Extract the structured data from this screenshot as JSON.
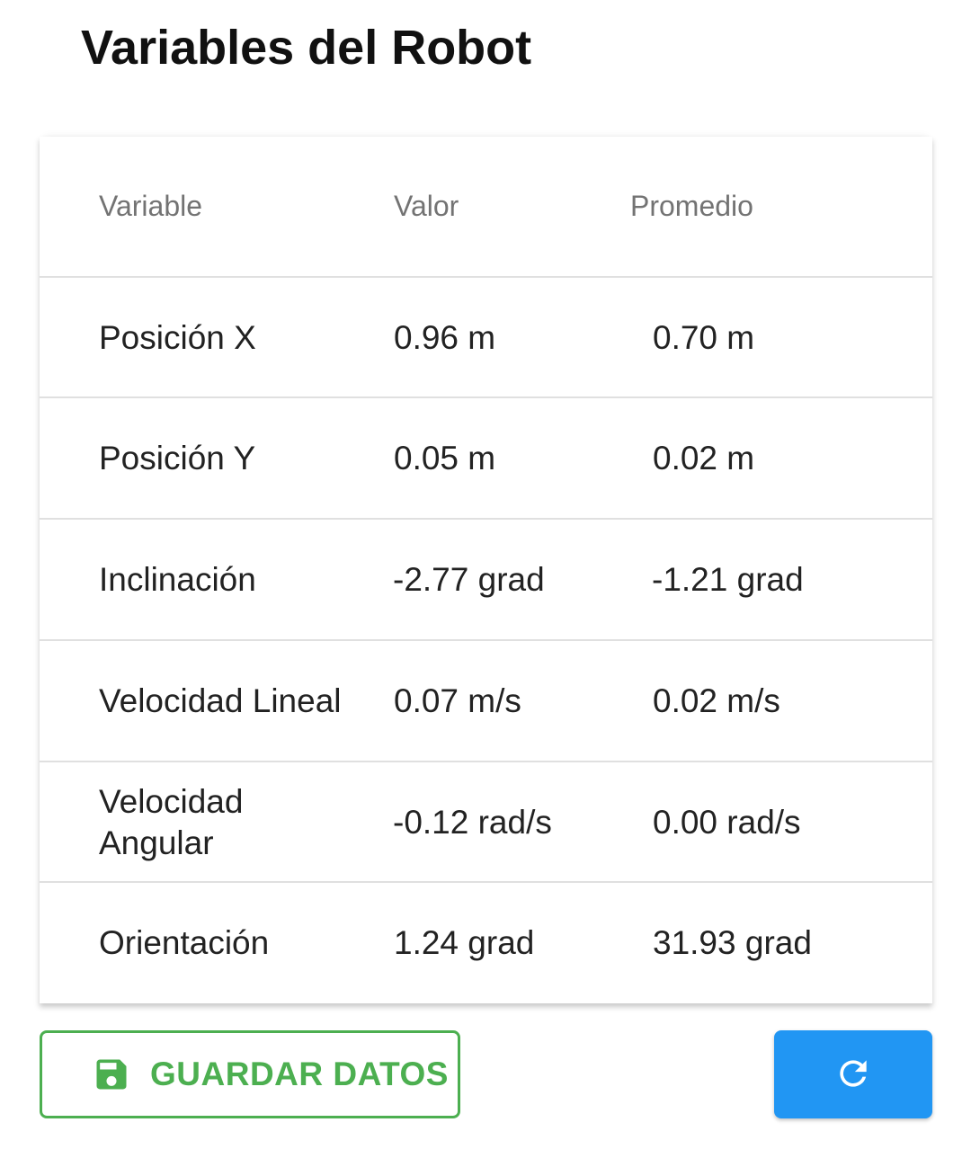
{
  "page": {
    "title": "Variables del Robot"
  },
  "table": {
    "headers": {
      "variable": "Variable",
      "value": "Valor",
      "average": "Promedio"
    },
    "rows": [
      {
        "variable": "Posición X",
        "value": "0.96 m",
        "average": "0.70 m"
      },
      {
        "variable": "Posición Y",
        "value": "0.05 m",
        "average": "0.02 m"
      },
      {
        "variable": "Inclinación",
        "value": "-2.77 grad",
        "average": "-1.21 grad"
      },
      {
        "variable": "Velocidad Lineal",
        "value": "0.07 m/s",
        "average": "0.02 m/s"
      },
      {
        "variable": "Velocidad Angular",
        "value": "-0.12 rad/s",
        "average": "0.00 rad/s"
      },
      {
        "variable": "Orientación",
        "value": "1.24 grad",
        "average": "31.93 grad"
      }
    ]
  },
  "actions": {
    "save_label": "GUARDAR DATOS",
    "save_icon": "floppy-disk-icon",
    "refresh_icon": "refresh-icon"
  },
  "colors": {
    "save_accent": "#4caf50",
    "refresh_bg": "#2196f3"
  }
}
